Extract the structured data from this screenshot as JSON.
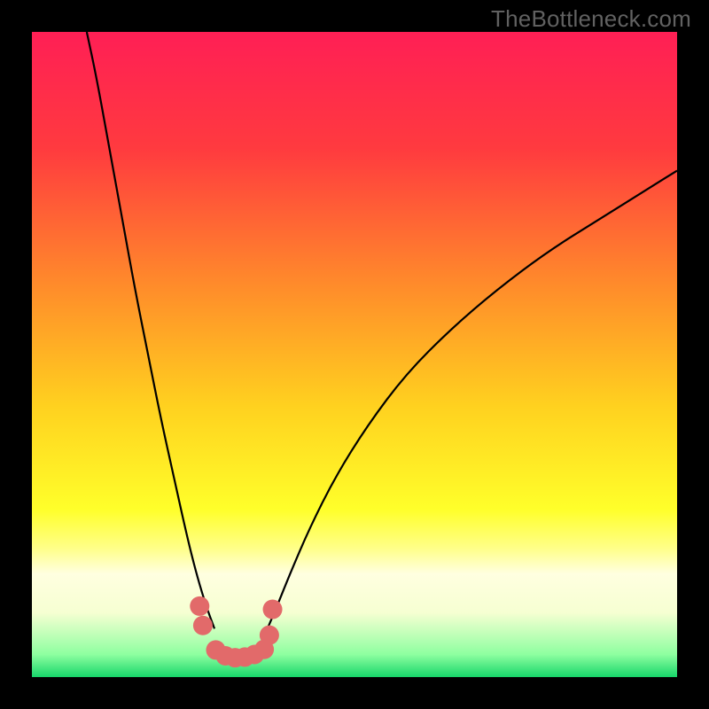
{
  "watermark": {
    "text": "TheBottleneck.com"
  },
  "chart_data": {
    "type": "line",
    "title": "",
    "xlabel": "",
    "ylabel": "",
    "xlim": [
      0,
      100
    ],
    "ylim": [
      0,
      100
    ],
    "grid": false,
    "legend": false,
    "background_gradient": {
      "stops": [
        {
          "offset": 0.0,
          "color": "#ff1f55"
        },
        {
          "offset": 0.18,
          "color": "#ff3a3f"
        },
        {
          "offset": 0.4,
          "color": "#ff8e2a"
        },
        {
          "offset": 0.58,
          "color": "#ffd11f"
        },
        {
          "offset": 0.74,
          "color": "#ffff2a"
        },
        {
          "offset": 0.8,
          "color": "#ffff88"
        },
        {
          "offset": 0.84,
          "color": "#ffffe0"
        },
        {
          "offset": 0.9,
          "color": "#f6ffd2"
        },
        {
          "offset": 0.965,
          "color": "#8effa0"
        },
        {
          "offset": 1.0,
          "color": "#17d66a"
        }
      ]
    },
    "series": [
      {
        "name": "left-branch",
        "color": "#000000",
        "x": [
          8.5,
          10,
          12,
          14,
          16,
          18,
          20,
          22,
          24,
          25.5,
          27,
          28.3
        ],
        "y": [
          100,
          93,
          82,
          71,
          60,
          50,
          40,
          31,
          22,
          16,
          11,
          7.5
        ]
      },
      {
        "name": "right-branch",
        "color": "#000000",
        "x": [
          36.5,
          38,
          40,
          43,
          47,
          52,
          58,
          65,
          72,
          80,
          88,
          96,
          100
        ],
        "y": [
          7.5,
          11,
          16,
          23,
          31,
          39,
          47,
          54,
          60,
          66,
          71,
          76,
          78.5
        ]
      },
      {
        "name": "basin-dots",
        "color": "#e26a6a",
        "style": "marker",
        "x": [
          26.0,
          26.5,
          28.5,
          30.0,
          31.5,
          33.0,
          34.5,
          36.0,
          36.8,
          37.3
        ],
        "y": [
          11.0,
          8.0,
          4.2,
          3.3,
          3.0,
          3.1,
          3.5,
          4.3,
          6.5,
          10.5
        ]
      }
    ]
  }
}
